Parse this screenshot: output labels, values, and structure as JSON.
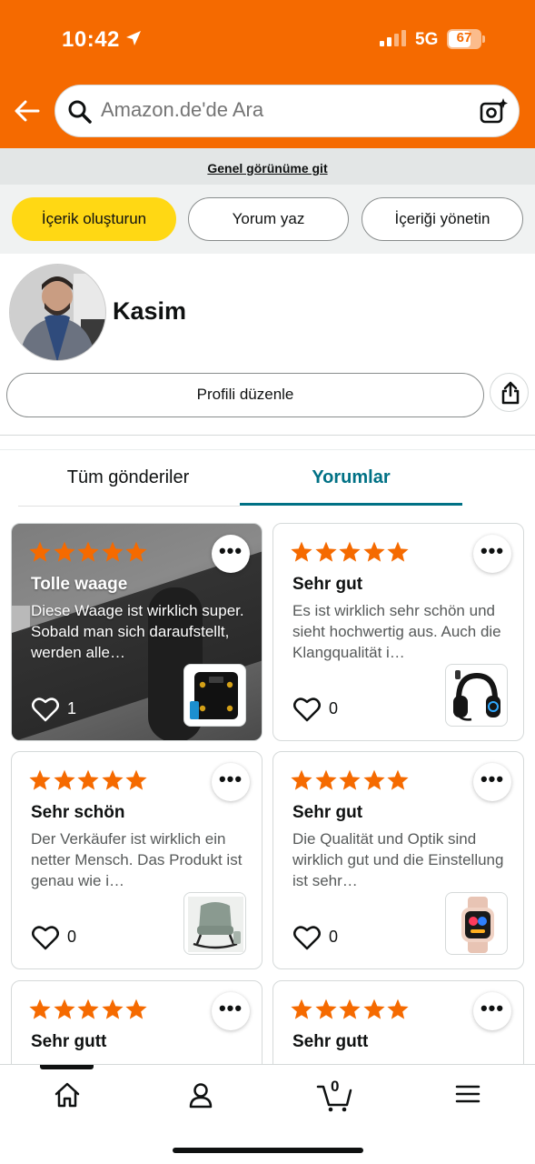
{
  "status": {
    "time": "10:42",
    "network": "5G",
    "battery": "67"
  },
  "search": {
    "placeholder": "Amazon.de'de Ara"
  },
  "banner": {
    "link": "Genel görünüme git"
  },
  "actions": {
    "create": "İçerik oluşturun",
    "review": "Yorum yaz",
    "manage": "İçeriği yönetin"
  },
  "profile": {
    "name": "Kasim",
    "edit_label": "Profili düzenle"
  },
  "tabs": [
    {
      "label": "Tüm gönderiler",
      "active": false
    },
    {
      "label": "Yorumlar",
      "active": true
    }
  ],
  "colors": {
    "header": "#f56a00",
    "primary_button": "#ffd814",
    "accent": "#007185",
    "star": "#f56a00"
  },
  "reviews": [
    {
      "stars": 5,
      "title": "Tolle waage",
      "body": "Diese Waage ist wirklich super. Sobald man sich daraufstellt, werden alle…",
      "likes": "1",
      "product": "smart scale"
    },
    {
      "stars": 5,
      "title": "Sehr gut",
      "body": "Es ist wirklich sehr schön und sieht hochwertig aus. Auch die Klangqualität i…",
      "likes": "0",
      "product": "gaming headset"
    },
    {
      "stars": 5,
      "title": "Sehr schön",
      "body": "Der Verkäufer ist wirklich ein netter Mensch. Das Produkt ist genau wie i…",
      "likes": "0",
      "product": "rocking chair"
    },
    {
      "stars": 5,
      "title": "Sehr gut",
      "body": "Die Qualität und Optik sind wirklich gut und die Einstellung ist sehr…",
      "likes": "0",
      "product": "smartwatch"
    },
    {
      "stars": 5,
      "title": "Sehr gutt",
      "body": "",
      "likes": "",
      "product": ""
    },
    {
      "stars": 5,
      "title": "Sehr gutt",
      "body": "",
      "likes": "",
      "product": ""
    }
  ],
  "bottom_nav": {
    "cart_count": "0",
    "items": [
      "home-icon",
      "account-icon",
      "cart-icon",
      "menu-icon"
    ]
  }
}
